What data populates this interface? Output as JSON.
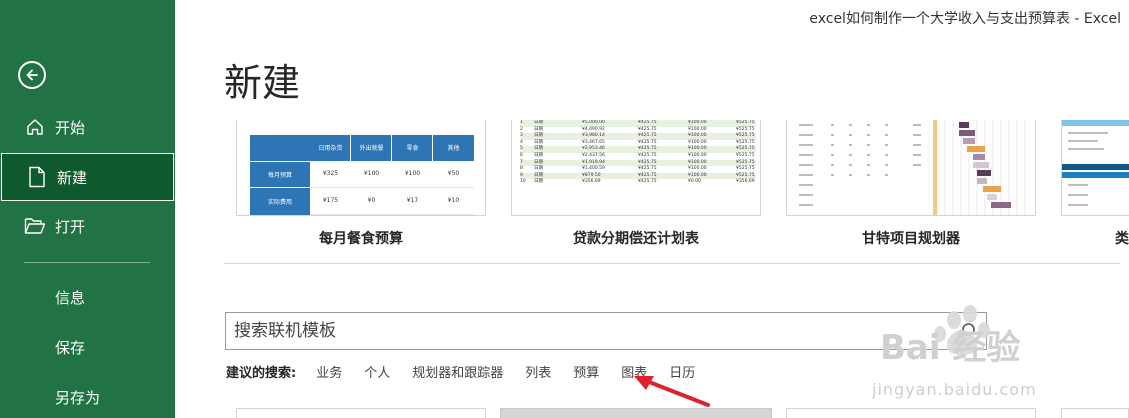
{
  "window": {
    "title": "excel如何制作一个大学收入与支出预算表  -  Excel"
  },
  "sidebar": {
    "nav": [
      {
        "label": "开始"
      },
      {
        "label": "新建"
      },
      {
        "label": "打开"
      }
    ],
    "text_items": [
      {
        "label": "信息"
      },
      {
        "label": "保存"
      },
      {
        "label": "另存为"
      }
    ],
    "colors": {
      "bg": "#217346",
      "active": "#0e5a2e"
    }
  },
  "main": {
    "title": "新建",
    "templates": [
      {
        "label": "每月餐食预算",
        "headers": [
          "日用杂货",
          "外出就餐",
          "零食",
          "其他"
        ],
        "rows": [
          {
            "name": "每月预算",
            "values": [
              "¥325",
              "¥100",
              "¥100",
              "¥50"
            ]
          },
          {
            "name": "实际费用",
            "values": [
              "¥175",
              "¥0",
              "¥17",
              "¥10"
            ]
          }
        ]
      },
      {
        "label": "贷款分期偿还计划表",
        "rows": [
          [
            "1",
            "日期",
            "¥5,000.00",
            "¥425.75",
            "¥100.00",
            "¥525.75"
          ],
          [
            "2",
            "日期",
            "¥4,490.92",
            "¥425.75",
            "¥100.00",
            "¥525.75"
          ],
          [
            "3",
            "日期",
            "¥3,980.14",
            "¥425.75",
            "¥100.00",
            "¥525.75"
          ],
          [
            "4",
            "日期",
            "¥3,467.65",
            "¥425.75",
            "¥100.00",
            "¥525.75"
          ],
          [
            "5",
            "日期",
            "¥2,953.46",
            "¥425.75",
            "¥100.00",
            "¥525.75"
          ],
          [
            "6",
            "日期",
            "¥2,437.56",
            "¥425.75",
            "¥100.00",
            "¥525.75"
          ],
          [
            "7",
            "日期",
            "¥1,919.94",
            "¥425.75",
            "¥100.00",
            "¥525.75"
          ],
          [
            "8",
            "日期",
            "¥1,400.59",
            "¥425.75",
            "¥100.00",
            "¥525.75"
          ],
          [
            "9",
            "日期",
            "¥879.50",
            "¥425.75",
            "¥100.00",
            "¥525.75"
          ],
          [
            "10",
            "日期",
            "¥356.69",
            "¥425.75",
            "¥0.00",
            "¥356.69"
          ]
        ]
      },
      {
        "label": "甘特项目规划器"
      },
      {
        "label": "类"
      }
    ],
    "search": {
      "placeholder": "搜索联机模板"
    },
    "suggested": {
      "label": "建议的搜索:",
      "items": [
        "业务",
        "个人",
        "规划器和跟踪器",
        "列表",
        "预算",
        "图表",
        "日历"
      ]
    }
  },
  "watermark": {
    "text": "Bai 经验",
    "sub": "jingyan.baidu.com"
  },
  "colors": {
    "accent_blue": "#2e75b6",
    "arrow_red": "#e0202a"
  }
}
